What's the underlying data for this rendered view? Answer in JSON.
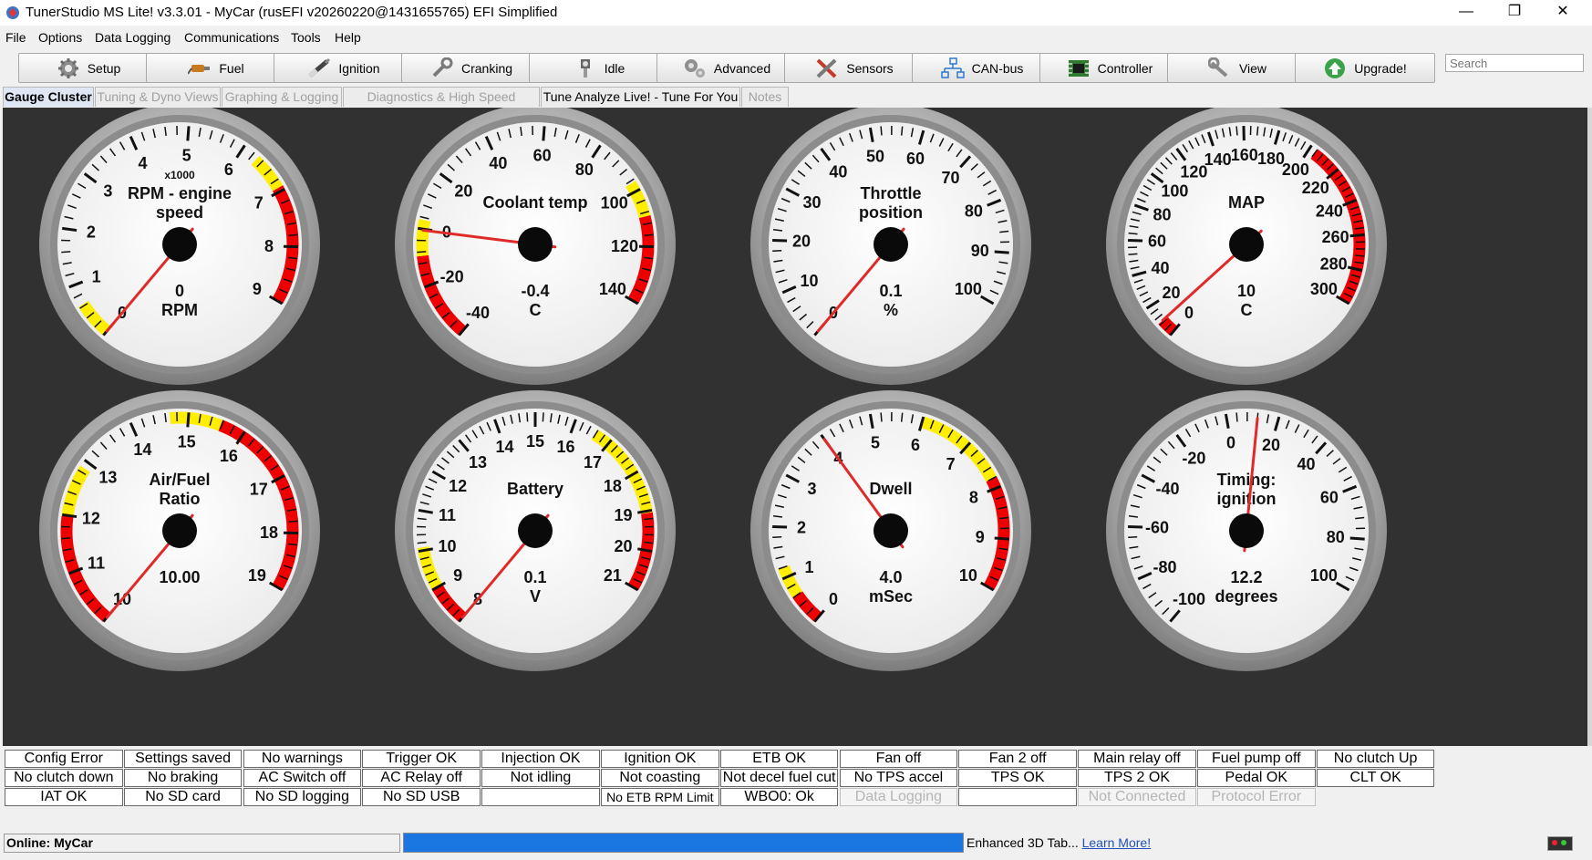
{
  "window": {
    "title": "TunerStudio MS Lite! v3.3.01 - MyCar (rusEFI v20260220@1431655765) EFI Simplified",
    "buttons": [
      "—",
      "❐",
      "✕"
    ]
  },
  "menu": [
    "File",
    "Options",
    "Data Logging",
    "Communications",
    "Tools",
    "Help"
  ],
  "search": {
    "placeholder": "Search"
  },
  "toolbar": [
    {
      "label": "Setup",
      "icon": "gear-icon"
    },
    {
      "label": "Fuel",
      "icon": "fuel-injector-icon"
    },
    {
      "label": "Ignition",
      "icon": "spark-plug-icon"
    },
    {
      "label": "Cranking",
      "icon": "wrench-icon"
    },
    {
      "label": "Idle",
      "icon": "idle-valve-icon"
    },
    {
      "label": "Advanced",
      "icon": "gears-icon"
    },
    {
      "label": "Sensors",
      "icon": "tools-icon"
    },
    {
      "label": "CAN-bus",
      "icon": "network-icon"
    },
    {
      "label": "Controller",
      "icon": "circuit-board-icon"
    },
    {
      "label": "View",
      "icon": "wrench-view-icon"
    },
    {
      "label": "Upgrade!",
      "icon": "upgrade-arrow-icon"
    }
  ],
  "tabs": [
    {
      "label": "Gauge Cluster",
      "state": "active"
    },
    {
      "label": "Tuning & Dyno Views",
      "state": "disabled"
    },
    {
      "label": "Graphing & Logging",
      "state": "disabled"
    },
    {
      "label": "Diagnostics & High Speed Loggers",
      "state": "disabled"
    },
    {
      "label": "Tune Analyze Live! - Tune For You",
      "state": "normal"
    },
    {
      "label": "Notes",
      "state": "disabled"
    }
  ],
  "gauges": [
    {
      "title": [
        "RPM - engine",
        "speed"
      ],
      "multiplier": "x1000",
      "value": "0",
      "unit": "RPM",
      "ticks": [
        "0",
        "1",
        "2",
        "3",
        "4",
        "5",
        "6",
        "7",
        "8",
        "9"
      ],
      "needle_fraction": 0.0,
      "bands": [
        {
          "from": 0.0,
          "to": 0.07,
          "color": "#ffee00"
        },
        {
          "from": 0.7,
          "to": 0.77,
          "color": "#ffee00"
        },
        {
          "from": 0.77,
          "to": 1.0,
          "color": "#ee0000"
        }
      ]
    },
    {
      "title": [
        "Coolant temp"
      ],
      "value": "-0.4",
      "unit": "C",
      "ticks": [
        "-40",
        "-20",
        "0",
        "20",
        "40",
        "60",
        "80",
        "100",
        "120",
        "140"
      ],
      "needle_fraction": 0.22,
      "bands": [
        {
          "from": 0.0,
          "to": 0.17,
          "color": "#ee0000"
        },
        {
          "from": 0.17,
          "to": 0.24,
          "color": "#ffee00"
        },
        {
          "from": 0.76,
          "to": 0.83,
          "color": "#ffee00"
        },
        {
          "from": 0.83,
          "to": 1.0,
          "color": "#ee0000"
        }
      ]
    },
    {
      "title": [
        "Throttle",
        "position"
      ],
      "value": "0.1",
      "unit": "%",
      "ticks": [
        "0",
        "10",
        "20",
        "30",
        "40",
        "50",
        "60",
        "70",
        "80",
        "90",
        "100"
      ],
      "needle_fraction": 0.0,
      "bands": []
    },
    {
      "title": [
        "MAP"
      ],
      "value": "10",
      "unit": "C",
      "ticks": [
        "0",
        "20",
        "40",
        "60",
        "80",
        "100",
        "120",
        "140",
        "160",
        "180",
        "200",
        "220",
        "240",
        "260",
        "280",
        "300"
      ],
      "needle_fraction": 0.03,
      "bands": [
        {
          "from": 0.0,
          "to": 0.03,
          "color": "#ee0000"
        },
        {
          "from": 0.68,
          "to": 1.0,
          "color": "#ee0000"
        }
      ]
    },
    {
      "title": [
        "Air/Fuel",
        "Ratio"
      ],
      "value": "10.00",
      "unit": "",
      "ticks": [
        "10",
        "11",
        "12",
        "13",
        "14",
        "15",
        "16",
        "17",
        "18",
        "19"
      ],
      "needle_fraction": 0.0,
      "bands": [
        {
          "from": 0.0,
          "to": 0.22,
          "color": "#ee0000"
        },
        {
          "from": 0.22,
          "to": 0.32,
          "color": "#ffee00"
        },
        {
          "from": 0.52,
          "to": 0.62,
          "color": "#ffee00"
        },
        {
          "from": 0.62,
          "to": 1.0,
          "color": "#ee0000"
        }
      ]
    },
    {
      "title": [
        "Battery"
      ],
      "value": "0.1",
      "unit": "V",
      "ticks": [
        "8",
        "9",
        "10",
        "11",
        "12",
        "13",
        "14",
        "15",
        "16",
        "17",
        "18",
        "19",
        "20",
        "21"
      ],
      "needle_fraction": 0.0,
      "bands": [
        {
          "from": 0.0,
          "to": 0.08,
          "color": "#ee0000"
        },
        {
          "from": 0.08,
          "to": 0.16,
          "color": "#ffee00"
        },
        {
          "from": 0.66,
          "to": 0.85,
          "color": "#ffee00"
        },
        {
          "from": 0.85,
          "to": 1.0,
          "color": "#ee0000"
        }
      ]
    },
    {
      "title": [
        "Dwell"
      ],
      "value": "4.0",
      "unit": "mSec",
      "ticks": [
        "0",
        "1",
        "2",
        "3",
        "4",
        "5",
        "6",
        "7",
        "8",
        "9",
        "10"
      ],
      "needle_fraction": 0.4,
      "bands": [
        {
          "from": 0.0,
          "to": 0.06,
          "color": "#ee0000"
        },
        {
          "from": 0.06,
          "to": 0.12,
          "color": "#ffee00"
        },
        {
          "from": 0.6,
          "to": 0.78,
          "color": "#ffee00"
        },
        {
          "from": 0.78,
          "to": 1.0,
          "color": "#ee0000"
        }
      ]
    },
    {
      "title": [
        "Timing:",
        "ignition"
      ],
      "value": "12.2",
      "unit": "degrees",
      "ticks": [
        "-100",
        "-80",
        "-60",
        "-40",
        "-20",
        "0",
        "20",
        "40",
        "60",
        "80",
        "100"
      ],
      "needle_fraction": 0.56,
      "bands": []
    }
  ],
  "indicators": [
    [
      "Config Error",
      "Settings saved",
      "No warnings",
      "Trigger OK",
      "Injection OK",
      "Ignition OK",
      "ETB OK",
      "Fan off",
      "Fan 2 off",
      "Main relay off",
      "Fuel pump off",
      "No clutch Up"
    ],
    [
      "No clutch down",
      "No braking",
      "AC Switch off",
      "AC Relay off",
      "Not idling",
      "Not coasting",
      "Not decel fuel cut",
      "No TPS accel",
      "TPS OK",
      "TPS 2 OK",
      "Pedal OK",
      "CLT OK"
    ],
    [
      "IAT OK",
      "No SD card",
      "No SD logging",
      "No SD USB",
      "",
      "No ETB RPM Limit",
      "WBO0: Ok",
      "Data Logging",
      "",
      "Not Connected",
      "Protocol Error"
    ]
  ],
  "indicator_disabled": [
    "Data Logging",
    "Not Connected",
    "Protocol Error"
  ],
  "status": {
    "connection": "Online: MyCar",
    "progress": 1.0,
    "ad_text": "Enhanced 3D Tab... ",
    "ad_link": "Learn More!"
  }
}
